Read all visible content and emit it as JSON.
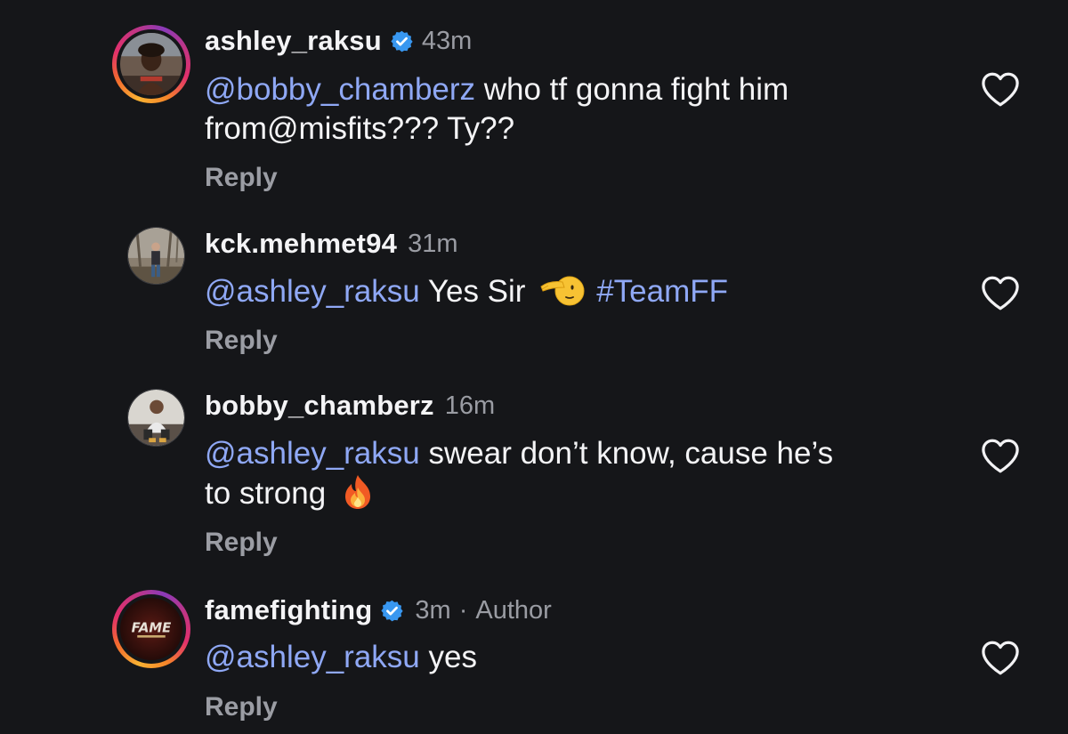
{
  "comments": [
    {
      "username": "ashley_raksu",
      "verified": true,
      "time": "43m",
      "mention": "@bobby_chamberz",
      "text_line1": " who tf gonna fight him",
      "text_line2": "from@misfits??? Ty??",
      "reply_label": "Reply",
      "avatar_style": "story-ring"
    },
    {
      "username": "kck.mehmet94",
      "verified": false,
      "time": "31m",
      "mention": "@ashley_raksu",
      "text": " Yes Sir ",
      "emoji": "saluting-face",
      "hashtag": "#TeamFF",
      "reply_label": "Reply",
      "avatar_style": "plain"
    },
    {
      "username": "bobby_chamberz",
      "verified": false,
      "time": "16m",
      "mention": "@ashley_raksu",
      "text_line1": " swear don’t know, cause he’s",
      "text_line2": "to strong ",
      "emoji": "fire",
      "reply_label": "Reply",
      "avatar_style": "plain"
    },
    {
      "username": "famefighting",
      "verified": true,
      "time": "3m",
      "separator": "·",
      "author_label": "Author",
      "mention": "@ashley_raksu",
      "text": " yes",
      "reply_label": "Reply",
      "avatar_style": "story-ring",
      "avatar_logo_text": "FAME"
    }
  ],
  "colors": {
    "background": "#151619",
    "mention": "#8fa8f5",
    "muted": "#9a9ca3",
    "verified": "#3897f0"
  },
  "icons": {
    "like": "heart-outline-icon",
    "verified": "verified-badge-icon"
  }
}
